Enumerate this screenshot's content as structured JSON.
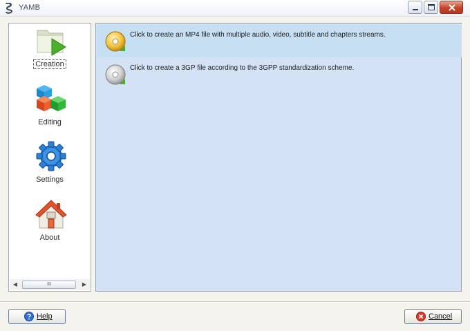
{
  "window": {
    "title": "YAMB"
  },
  "nav": {
    "items": [
      {
        "label": "Creation",
        "icon": "folder-play-icon",
        "active": true
      },
      {
        "label": "Editing",
        "icon": "cubes-icon",
        "active": false
      },
      {
        "label": "Settings",
        "icon": "gear-icon",
        "active": false
      },
      {
        "label": "About",
        "icon": "house-icon",
        "active": false
      }
    ],
    "scrollbar": {
      "thumb_grip": "III"
    }
  },
  "content": {
    "options": [
      {
        "text": "Click to create an MP4 file with multiple audio, video, subtitle and chapters streams.",
        "icon": "gold-disc-icon",
        "selected": true
      },
      {
        "text": "Click to create a 3GP file according to the 3GPP standardization scheme.",
        "icon": "silver-disc-icon",
        "selected": false
      }
    ]
  },
  "buttons": {
    "help": "Help",
    "cancel": "Cancel"
  },
  "colors": {
    "content_bg": "#d4e2f6",
    "selected_row": "#c6dff3",
    "close_button": "#c4432a"
  }
}
